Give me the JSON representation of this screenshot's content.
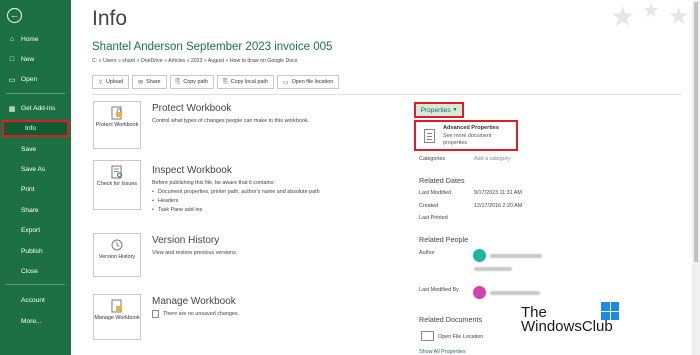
{
  "sidebar": {
    "items": [
      {
        "label": "Home"
      },
      {
        "label": "New"
      },
      {
        "label": "Open"
      },
      {
        "label": "Get Add-ins"
      },
      {
        "label": "Info"
      },
      {
        "label": "Save"
      },
      {
        "label": "Save As"
      },
      {
        "label": "Print"
      },
      {
        "label": "Share"
      },
      {
        "label": "Export"
      },
      {
        "label": "Publish"
      },
      {
        "label": "Close"
      },
      {
        "label": "Account"
      },
      {
        "label": "More..."
      }
    ]
  },
  "header": {
    "title": "Info",
    "doc_title": "Shantel Anderson September 2023 invoice 005",
    "path": "C: » Users » shant » OneDrive » Articles » 2023 » August » How to draw on Google Docs"
  },
  "actions": [
    {
      "label": "Upload"
    },
    {
      "label": "Share"
    },
    {
      "label": "Copy path"
    },
    {
      "label": "Copy local path"
    },
    {
      "label": "Open file location"
    }
  ],
  "sections": {
    "protect": {
      "button": "Protect Workbook",
      "heading": "Protect Workbook",
      "desc": "Control what types of changes people can make to this workbook."
    },
    "inspect": {
      "button": "Check for Issues",
      "heading": "Inspect Workbook",
      "desc": "Before publishing this file, be aware that it contains:",
      "bullets": [
        "Document properties, printer path, author's name and absolute path",
        "Headers",
        "Task Pane add-ins"
      ]
    },
    "version": {
      "button": "Version History",
      "heading": "Version History",
      "desc": "View and restore previous versions."
    },
    "manage": {
      "button": "Manage Workbook",
      "heading": "Manage Workbook",
      "desc": "There are no unsaved changes."
    }
  },
  "properties": {
    "button": "Properties",
    "advanced_title": "Advanced Properties",
    "advanced_desc": "See more document properties",
    "categories_label": "Categories",
    "categories_value": "Add a category",
    "related_dates": "Related Dates",
    "last_modified_label": "Last Modified",
    "last_modified_value": "9/17/2023 11:31 AM",
    "created_label": "Created",
    "created_value": "12/17/2016 2:20 AM",
    "last_printed_label": "Last Printed",
    "related_people": "Related People",
    "author_label": "Author",
    "last_modified_by_label": "Last Modified By",
    "related_documents": "Related Documents",
    "open_file_location": "Open File Location",
    "show_all": "Show All Properties"
  },
  "watermark": {
    "line1": "The",
    "line2": "WindowsClub"
  },
  "colors": {
    "sidebar": "#1d7044",
    "accent": "#1d7044",
    "highlight": "#e31b23",
    "author_avatar": "#1fb5a3",
    "modifier_avatar": "#d63fb0"
  }
}
